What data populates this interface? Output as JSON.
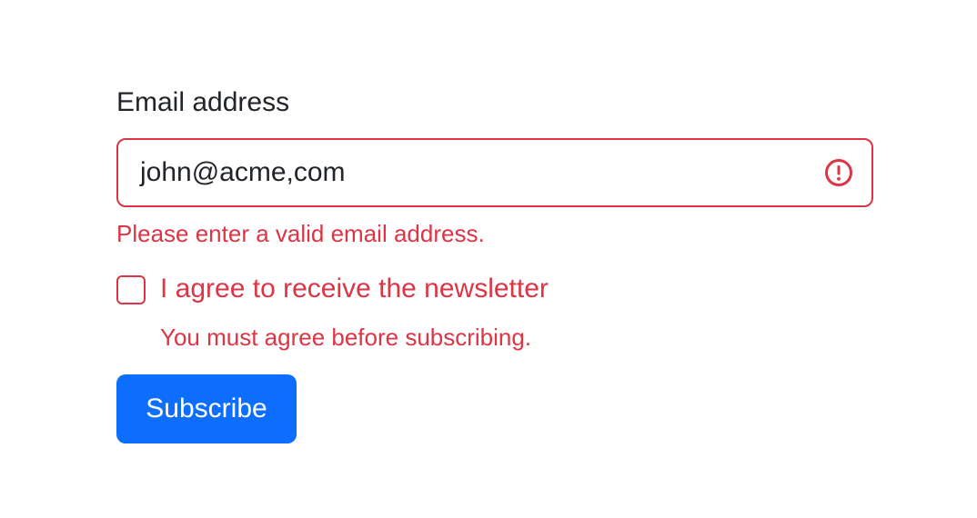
{
  "email": {
    "label": "Email address",
    "value": "john@acme,com",
    "state": "invalid",
    "icon": "exclamation-circle-icon",
    "feedback": "Please enter a valid email address."
  },
  "newsletter": {
    "label": "I agree to receive the newsletter",
    "checked": false,
    "feedback": "You must agree before subscribing."
  },
  "submit": {
    "label": "Subscribe"
  },
  "colors": {
    "invalid": "#dc3545",
    "primary": "#0d6efd",
    "text": "#212529",
    "background": "#ffffff"
  }
}
